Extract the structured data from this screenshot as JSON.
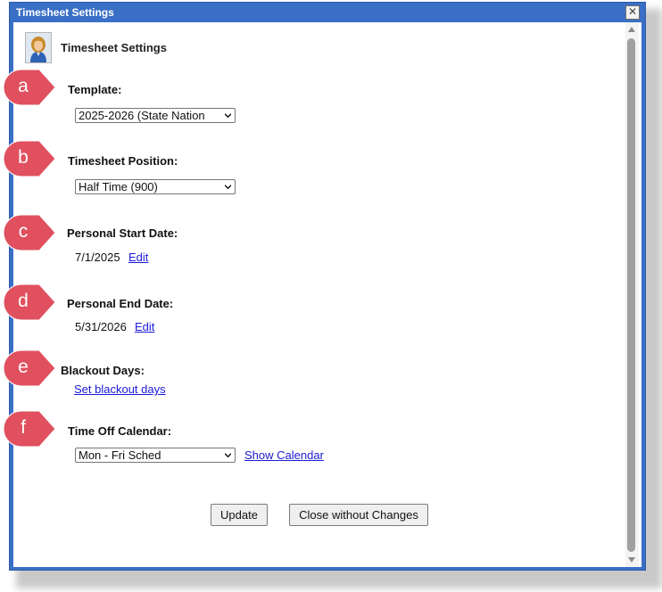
{
  "window": {
    "title": "Timesheet Settings",
    "close_label": "✕"
  },
  "header": {
    "title": "Timesheet Settings"
  },
  "markers": [
    "a",
    "b",
    "c",
    "d",
    "e",
    "f"
  ],
  "fields": {
    "template": {
      "label": "Template:",
      "value": "2025-2026 (State Nation"
    },
    "position": {
      "label": "Timesheet Position:",
      "value": "Half Time (900)"
    },
    "start_date": {
      "label": "Personal Start Date:",
      "value": "7/1/2025",
      "edit_label": "Edit"
    },
    "end_date": {
      "label": "Personal End Date:",
      "value": "5/31/2026",
      "edit_label": "Edit"
    },
    "blackout": {
      "label": "Blackout Days:",
      "link_label": "Set blackout days"
    },
    "calendar": {
      "label": "Time Off Calendar:",
      "value": "Mon - Fri Sched",
      "link_label": "Show Calendar"
    }
  },
  "buttons": {
    "update": "Update",
    "close": "Close without Changes"
  },
  "colors": {
    "titlebar": "#3a6fc6",
    "marker": "#e0505e",
    "link": "#1a1ad6"
  }
}
